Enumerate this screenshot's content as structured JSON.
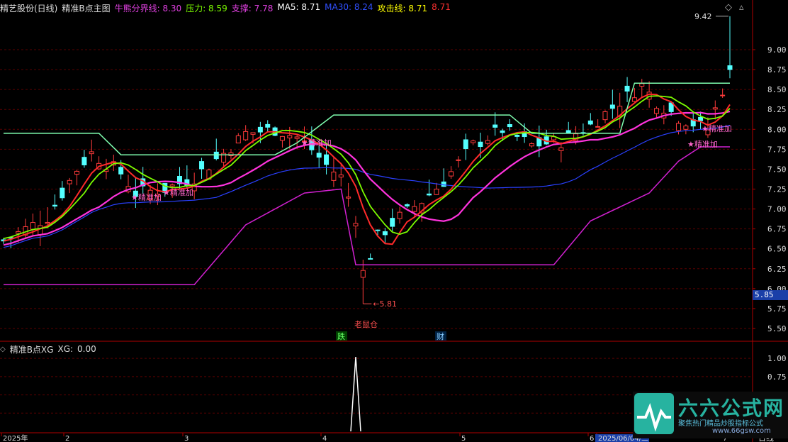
{
  "header": {
    "stock": "精艺股份(日线)",
    "indicator": "精准B点主图",
    "fields": [
      {
        "label": "牛熊分界线:",
        "value": "8.30",
        "color": "#e040e0"
      },
      {
        "label": "压力:",
        "value": "8.59",
        "color": "#7cfc00"
      },
      {
        "label": "支撑:",
        "value": "7.78",
        "color": "#e040e0"
      },
      {
        "label": "MA5:",
        "value": "8.71",
        "color": "#ffffff"
      },
      {
        "label": "MA30:",
        "value": "8.24",
        "color": "#3050ff"
      },
      {
        "label": "攻击线:",
        "value": "8.71",
        "color": "#ffff00"
      },
      {
        "label": "",
        "value": "8.71",
        "color": "#ff3030"
      }
    ]
  },
  "sub_header": {
    "indicator": "精准B点XG",
    "label": "XG:",
    "value": "0.00"
  },
  "price_axis": [
    "9.00",
    "8.75",
    "8.50",
    "8.25",
    "8.00",
    "7.75",
    "7.50",
    "7.25",
    "7.00",
    "6.75",
    "6.50",
    "6.25",
    "6.00",
    "5.75",
    "5.50"
  ],
  "sub_axis": [
    "1.00",
    "0.75",
    "0.50",
    "0.25"
  ],
  "current_price": "5.85",
  "annotations": {
    "high": "9.42",
    "low": "5.81",
    "low_label": "老鼠仓",
    "signal": "精准加",
    "signal_left": "精准加",
    "tag_fall": "跌",
    "tag_fin": "财"
  },
  "x_axis": [
    "2025年",
    "2",
    "3",
    "4",
    "5",
    "6",
    "2025/06/04/三",
    "7"
  ],
  "period": "日线",
  "watermark": {
    "brand": "六六公式网",
    "slogan": "聚焦热门精品炒股指标公式",
    "url": "www.66gsw.com"
  }
}
